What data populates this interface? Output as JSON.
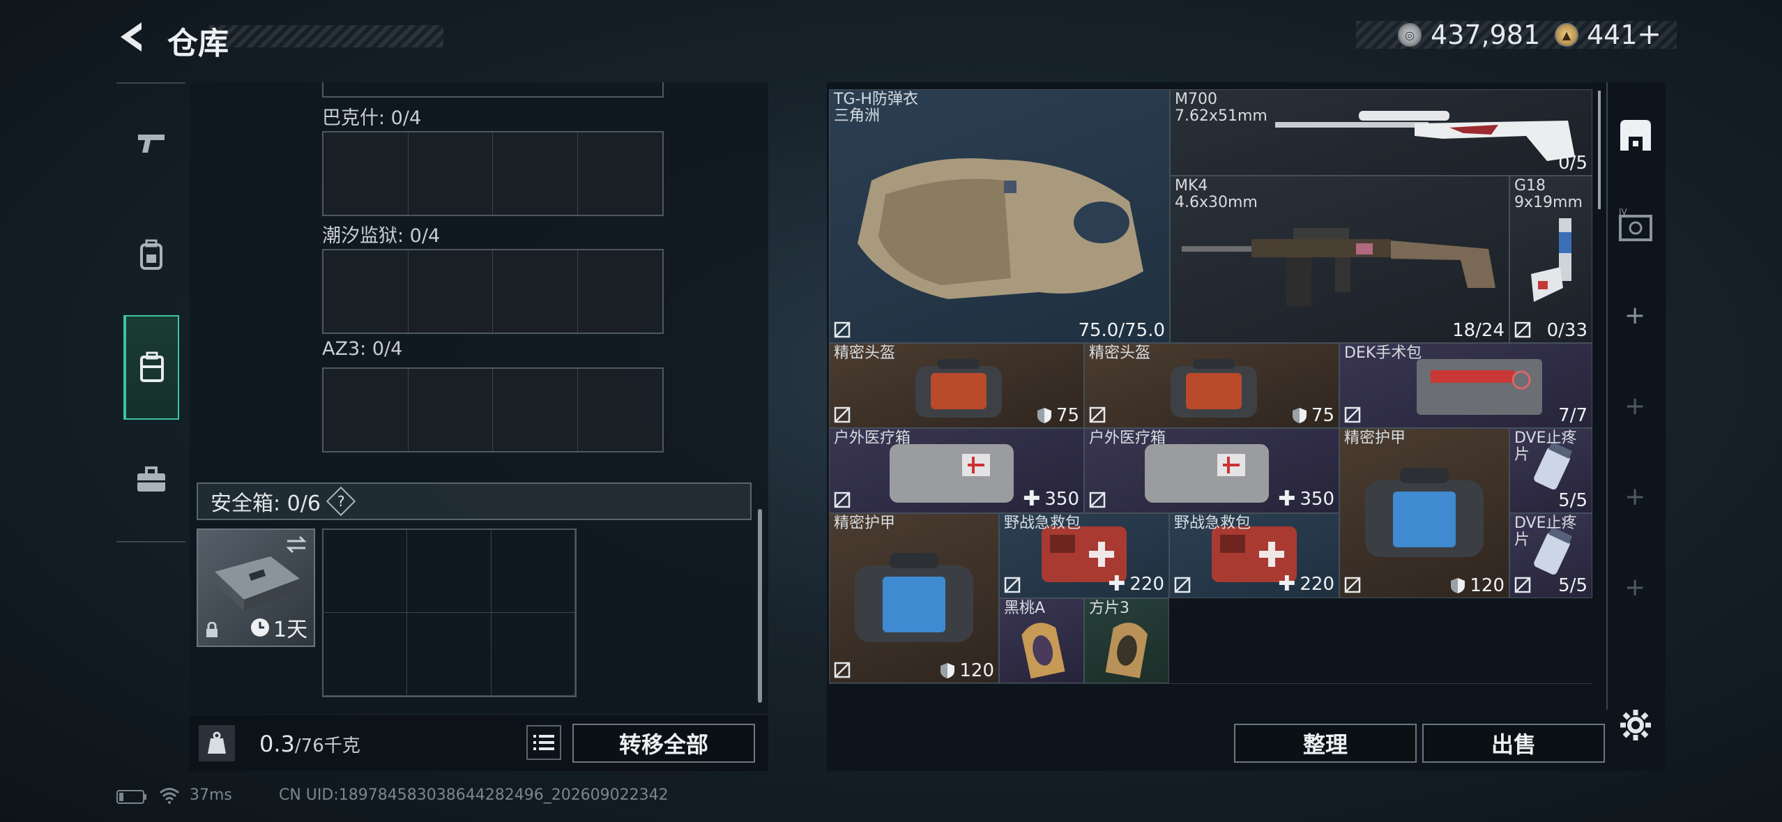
{
  "header": {
    "title": "仓库",
    "currency_silver": "437,981",
    "currency_gold": "441",
    "currency_add": "+"
  },
  "left": {
    "categories": [
      "pistol-icon",
      "backpack-icon",
      "case-icon",
      "briefcase-icon"
    ],
    "sections": [
      {
        "label": "巴克什: 0/4"
      },
      {
        "label": "潮汐监狱: 0/4"
      },
      {
        "label": "AZ3: 0/4"
      }
    ],
    "safebox": {
      "label": "安全箱: 0/6",
      "help": "?",
      "duration": "1天"
    },
    "weight": {
      "value": "0.3",
      "max": "/76千克"
    },
    "transfer_all": "转移全部"
  },
  "right": {
    "items": [
      {
        "name": "TG-H防弹衣",
        "sub": "三角洲",
        "value": "75.0/75.0"
      },
      {
        "name": "M700",
        "sub": "7.62x51mm",
        "value": "0/5"
      },
      {
        "name": "MK4",
        "sub": "4.6x30mm",
        "value": "18/24"
      },
      {
        "name": "G18",
        "sub": "9x19mm",
        "value": "0/33"
      },
      {
        "name": "精密头盔",
        "value": "75"
      },
      {
        "name": "精密头盔",
        "value": "75"
      },
      {
        "name": "DEK手术包",
        "value": "7/7"
      },
      {
        "name": "户外医疗箱",
        "value": "350"
      },
      {
        "name": "户外医疗箱",
        "value": "350"
      },
      {
        "name": "精密护甲",
        "value": "120"
      },
      {
        "name": "DVE止疼片",
        "value": "5/5"
      },
      {
        "name": "DVE止疼片",
        "value": "5/5"
      },
      {
        "name": "精密护甲",
        "value": "120"
      },
      {
        "name": "野战急救包",
        "value": "220"
      },
      {
        "name": "野战急救包",
        "value": "220"
      },
      {
        "name": "黑桃A"
      },
      {
        "name": "方片3"
      }
    ],
    "sort": "整理",
    "sell": "出售"
  },
  "status": {
    "ping": "37ms",
    "uid": "CN UID:18978458303864428249​6_202609022342"
  }
}
